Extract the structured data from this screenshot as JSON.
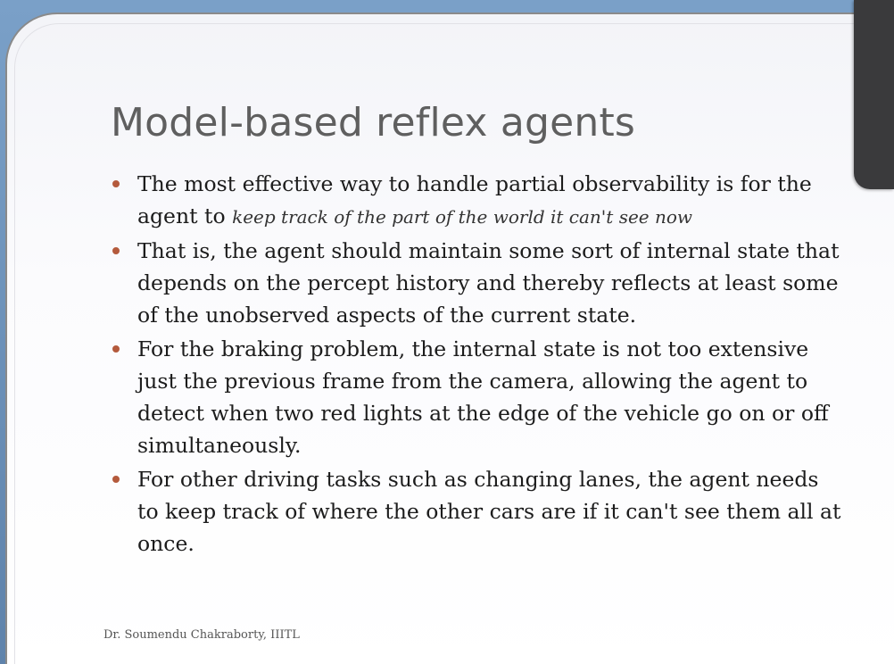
{
  "slide": {
    "title": "Model-based reflex agents",
    "bullets": [
      {
        "text": "The most effective way to handle partial observability is for the agent to ",
        "emphasis": "keep track of the part of the world it can't see now"
      },
      {
        "text": "That is, the agent should maintain some sort of internal state that depends on the percept history and thereby reflects at least some of the unobserved aspects of the current state."
      },
      {
        "text": "For the braking problem, the internal state is not too extensive just the previous frame from the camera, allowing the agent to detect when two red lights at the edge of the vehicle go on or off simultaneously."
      },
      {
        "text": "For other driving tasks such as changing lanes, the agent needs to keep track of where the other cars are if it can't see them all at once."
      }
    ],
    "footer": "Dr. Soumendu Chakraborty, IIITL"
  },
  "colors": {
    "bullet": "#b45a3c",
    "title": "#5f5f5f",
    "body_text": "#1c1c1c"
  }
}
